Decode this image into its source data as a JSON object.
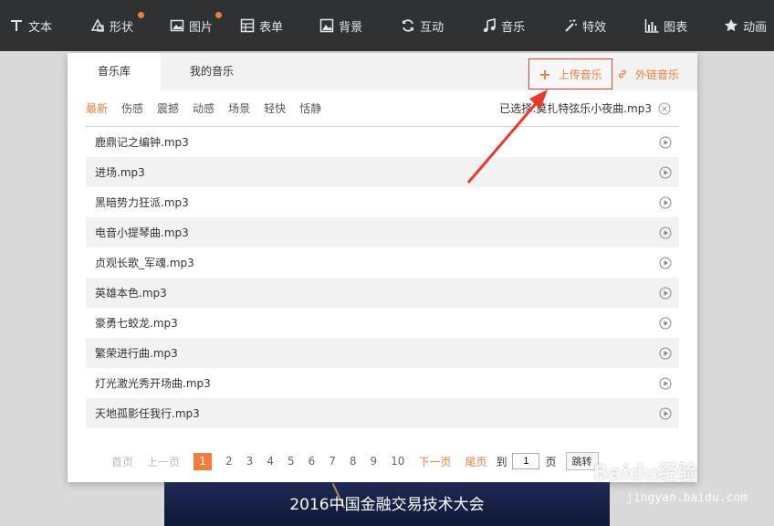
{
  "toolbar": {
    "items": [
      {
        "label": "文本",
        "icon": "text-icon"
      },
      {
        "label": "形状",
        "icon": "shape-icon"
      },
      {
        "label": "图片",
        "icon": "image-icon"
      },
      {
        "label": "表单",
        "icon": "form-icon"
      },
      {
        "label": "背景",
        "icon": "background-icon"
      },
      {
        "label": "互动",
        "icon": "refresh-icon"
      },
      {
        "label": "音乐",
        "icon": "music-icon"
      },
      {
        "label": "特效",
        "icon": "magic-wand-icon"
      },
      {
        "label": "图表",
        "icon": "bar-chart-icon"
      },
      {
        "label": "动画",
        "icon": "star-icon"
      }
    ],
    "accent": "#f07d3a",
    "bg": "#2f3133"
  },
  "dialog": {
    "tabs": [
      "音乐库",
      "我的音乐"
    ],
    "upload_label": "上传音乐",
    "link_label": "外链音乐",
    "filters": [
      "最新",
      "伤感",
      "震撼",
      "动感",
      "场景",
      "轻快",
      "恬静"
    ],
    "selected_text": "已选择:莫扎特弦乐小夜曲.mp3",
    "tracks": [
      "鹿鼎记之编钟.mp3",
      "进场.mp3",
      "黑暗势力狂派.mp3",
      "电音小提琴曲.mp3",
      "贞观长歌_军魂.mp3",
      "英雄本色.mp3",
      "豪勇七蛟龙.mp3",
      "繁荣进行曲.mp3",
      "灯光激光秀开场曲.mp3",
      "天地孤影任我行.mp3"
    ],
    "pager": {
      "first": "首页",
      "prev": "上一页",
      "pages": [
        "1",
        "2",
        "3",
        "4",
        "5",
        "6",
        "7",
        "8",
        "9",
        "10"
      ],
      "current": "1",
      "next": "下一页",
      "last": "尾页",
      "goto_prefix": "到",
      "goto_value": "1",
      "goto_suffix": "页",
      "jump": "跳转"
    }
  },
  "banner": {
    "title": "2016中国金融交易技术大会"
  },
  "watermark": {
    "brand": "Baidu经验",
    "url": "jingyan.baidu.com"
  }
}
